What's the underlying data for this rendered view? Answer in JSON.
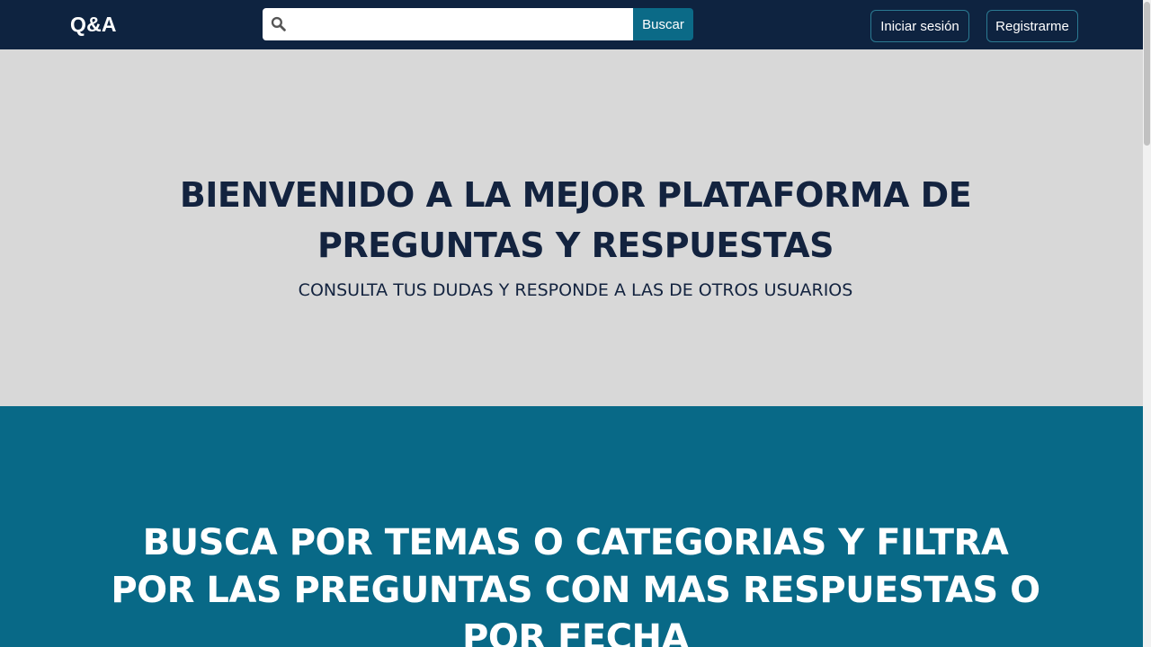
{
  "navbar": {
    "brand": "Q&A",
    "search": {
      "placeholder": "",
      "value": "",
      "button_label": "Buscar",
      "icon": "search-icon"
    },
    "login_label": "Iniciar sesión",
    "register_label": "Registrarme"
  },
  "hero": {
    "title": "BIENVENIDO A LA MEJOR PLATAFORMA DE PREGUNTAS Y RESPUESTAS",
    "subtitle": "CONSULTA TUS DUDAS Y RESPONDE A LAS DE OTROS USUARIOS"
  },
  "feature": {
    "title": "BUSCA POR TEMAS O CATEGORIAS Y FILTRA POR LAS PREGUNTAS CON MAS RESPUESTAS O POR FECHA"
  },
  "colors": {
    "navbar_bg": "#0e2340",
    "hero_bg": "#d8d8d8",
    "feature_bg": "#086987",
    "accent": "#0b6a87",
    "text_dark": "#13233f"
  }
}
